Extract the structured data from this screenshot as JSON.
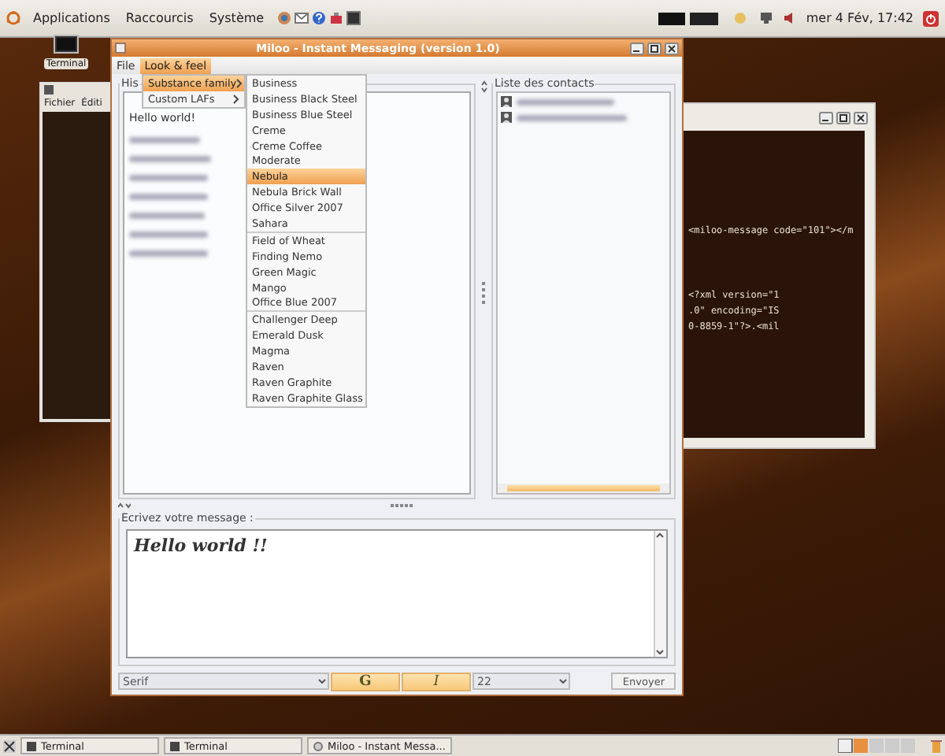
{
  "top_panel": {
    "menus": [
      "Applications",
      "Raccourcis",
      "Système"
    ],
    "clock": "mer 4 Fév, 17:42"
  },
  "desktop_icons": [
    {
      "label": "Terminal"
    }
  ],
  "terminal_left": {
    "menus": [
      "Fichier",
      "Éditi"
    ]
  },
  "terminal_right": {
    "lines": [
      "<miloo-message code=\"101\"></m",
      "<?xml version=\"1",
      ".0\" encoding=\"IS",
      "0-8859-1\"?>.<mil"
    ]
  },
  "window": {
    "title": "Miloo - Instant Messaging (version 1.0)",
    "menubar": [
      {
        "label": "File",
        "selected": false
      },
      {
        "label": "Look & feel",
        "selected": true
      }
    ],
    "menu": [
      {
        "label": "Substance family",
        "selected": true
      },
      {
        "label": "Custom LAFs",
        "selected": false
      }
    ],
    "submenu": [
      {
        "items": [
          {
            "label": "Business",
            "selected": false
          },
          {
            "label": "Business Black Steel",
            "selected": false
          },
          {
            "label": "Business Blue Steel",
            "selected": false
          },
          {
            "label": "Creme",
            "selected": false
          },
          {
            "label": "Creme Coffee",
            "selected": false
          },
          {
            "label": "Moderate",
            "selected": false
          },
          {
            "label": "Nebula",
            "selected": true
          },
          {
            "label": "Nebula Brick Wall",
            "selected": false
          },
          {
            "label": "Office Silver 2007",
            "selected": false
          },
          {
            "label": "Sahara",
            "selected": false
          }
        ]
      },
      {
        "items": [
          {
            "label": "Field of Wheat",
            "selected": false
          },
          {
            "label": "Finding Nemo",
            "selected": false
          },
          {
            "label": "Green Magic",
            "selected": false
          },
          {
            "label": "Mango",
            "selected": false
          },
          {
            "label": "Office Blue 2007",
            "selected": false
          }
        ]
      },
      {
        "items": [
          {
            "label": "Challenger Deep",
            "selected": false
          },
          {
            "label": "Emerald Dusk",
            "selected": false
          },
          {
            "label": "Magma",
            "selected": false
          },
          {
            "label": "Raven",
            "selected": false
          },
          {
            "label": "Raven Graphite",
            "selected": false
          },
          {
            "label": "Raven Graphite Glass",
            "selected": false
          }
        ]
      }
    ],
    "history": {
      "title": "His",
      "messages": [
        "Hello world!"
      ]
    },
    "contacts": {
      "title": "Liste des contacts"
    },
    "compose": {
      "title": "Ecrivez votre message :",
      "text": "Hello world !!"
    },
    "toolbar": {
      "font": "Serif",
      "bold": "G",
      "italic": "I",
      "size": "22",
      "send": "Envoyer"
    }
  },
  "taskbar": [
    {
      "label": "Terminal"
    },
    {
      "label": "Terminal"
    },
    {
      "label": "Miloo - Instant Messa..."
    }
  ]
}
